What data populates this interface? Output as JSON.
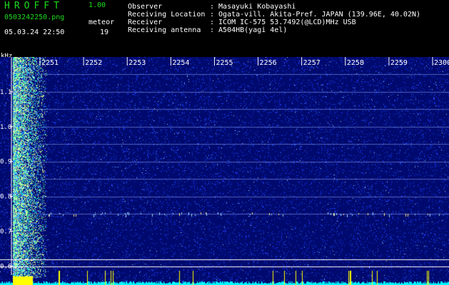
{
  "header": {
    "app_title": "HROFFT",
    "version": "1.00",
    "file_name": "0503242250.png",
    "datetime": "05.03.24 22:50",
    "count_label": "meteor",
    "count_value": "19"
  },
  "info": [
    {
      "key": "Observer",
      "value": ": Masayuki Kobayashi"
    },
    {
      "key": "Receiving Location",
      "value": ": Ogata-vill. Akita-Pref. JAPAN (139.96E, 40.02N)"
    },
    {
      "key": "Receiver",
      "value": ": ICOM IC-575 53.7492(@LCD)MHz USB"
    },
    {
      "key": "Receiving antenna",
      "value": ": A504HB(yagi 4el)"
    }
  ],
  "plot": {
    "unit_label": "kHz",
    "time_labels": [
      "2251",
      "2252",
      "2253",
      "2254",
      "2255",
      "2256",
      "2257",
      "2258",
      "2259",
      "2300"
    ],
    "freq_labels": [
      "1.1",
      "1.0",
      "0.9",
      "0.8",
      "0.7",
      "0.6"
    ],
    "colors": {
      "background": "#000a6e",
      "noise": "#1e3cff",
      "axis": "#ffffff",
      "ticks": "#ffff00",
      "cyan": "#00ffff"
    }
  },
  "chart_data": {
    "type": "heatmap",
    "title": "",
    "xlabel": "",
    "ylabel": "kHz",
    "x_ticks": [
      "2251",
      "2252",
      "2253",
      "2254",
      "2255",
      "2256",
      "2257",
      "2258",
      "2259",
      "2300"
    ],
    "y_ticks": [
      1.1,
      1.0,
      0.9,
      0.8,
      0.7,
      0.6
    ],
    "ylim": [
      0.57,
      1.2
    ],
    "horizontal_lines_khz": [
      1.15,
      1.1,
      1.05,
      1.0,
      0.95,
      0.9,
      0.85,
      0.8,
      0.75
    ],
    "meteor_count": 19
  }
}
